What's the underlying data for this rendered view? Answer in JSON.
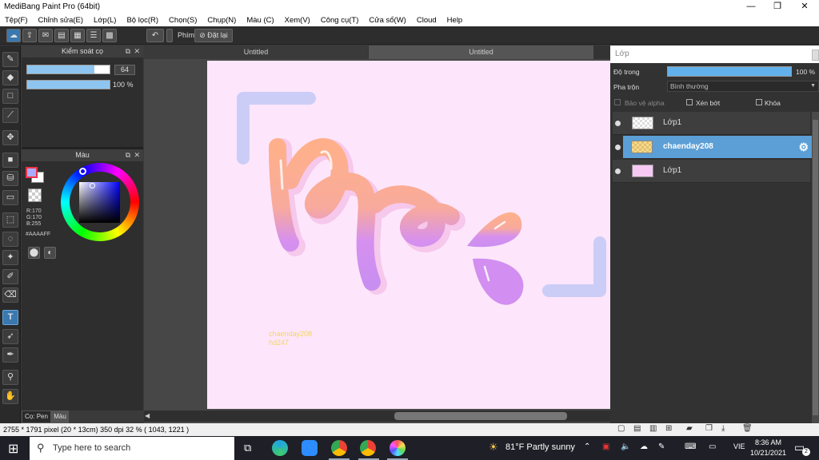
{
  "window": {
    "title": "MediBang Paint Pro (64bit)",
    "minimize": "—",
    "maximize": "❐",
    "close": "✕"
  },
  "menu": [
    "Tệp(F)",
    "Chỉnh sửa(E)",
    "Lớp(L)",
    "Bộ lọc(R)",
    "Chọn(S)",
    "Chụp(N)",
    "Màu (C)",
    "Xem(V)",
    "Công cụ(T)",
    "Cửa sổ(W)",
    "Cloud",
    "Help"
  ],
  "toolbar": {
    "shortcut_label": "Phím",
    "reset_label": "Đặt lại"
  },
  "brush_panel": {
    "title": "Kiểm soát cọ",
    "size_value": "64",
    "size_fraction": 0.82,
    "opacity_value": "100 %",
    "opacity_fraction": 1.0
  },
  "color_panel": {
    "title": "Màu",
    "r": "R:170",
    "g": "G:170",
    "b": "B:255",
    "hex": "#AAAAFF",
    "primary": "#aaaaff",
    "secondary": "#ffffff"
  },
  "left_tabs": {
    "pen": "Cọ: Pen",
    "color": "Màu"
  },
  "canvas_tabs": [
    "Untitled",
    "Untitled"
  ],
  "canvas_text": {
    "line1": "chaenday208",
    "line2": "hd247"
  },
  "layer_panel": {
    "title": "Lớp",
    "opacity_label": "Độ trong",
    "opacity_value": "100 %",
    "opacity_fraction": 1.0,
    "blend_label": "Pha trộn",
    "blend_value": "Bình thường",
    "protect_alpha": "Bảo vệ alpha",
    "clipping": "Xén bớt",
    "lock": "Khóa",
    "layers": [
      {
        "name": "Lớp1",
        "selected": false
      },
      {
        "name": "chaenday208",
        "selected": true
      },
      {
        "name": "Lớp1",
        "selected": false
      }
    ]
  },
  "statusbar": {
    "text": "2755 * 1791 pixel  (20 * 13cm)  350 dpi  32 %  ( 1043, 1221 )"
  },
  "taskbar": {
    "search_placeholder": "Type here to search",
    "weather": "81°F  Partly sunny",
    "lang": "VIE",
    "time": "8:36 AM",
    "date": "10/21/2021",
    "notifications": "2"
  }
}
